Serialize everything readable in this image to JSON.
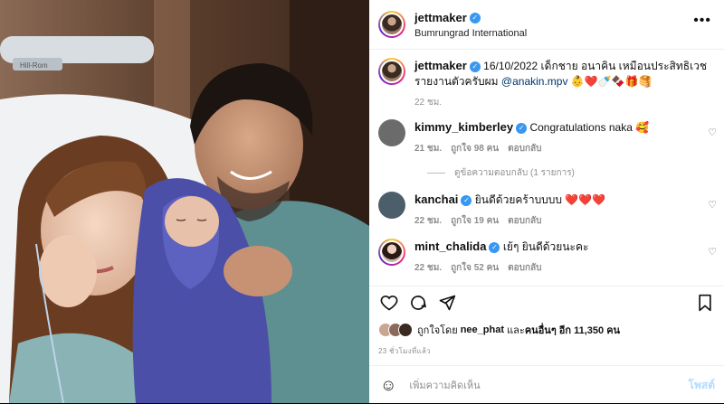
{
  "post_header": {
    "username": "jettmaker",
    "location": "Bumrungrad International",
    "more_icon": "more-horizontal-icon"
  },
  "caption": {
    "username": "jettmaker",
    "text": "16/10/2022 เด็กชาย อนาคิน เหมือนประสิทธิเวช รายงานตัวครับผม",
    "mention": "@anakin.mpv",
    "emojis": "👶❤️🍼🍫🎁🥞",
    "time": "22 ชม."
  },
  "comments": [
    {
      "username": "kimmy_kimberley",
      "text": "Congratulations naka 🥰",
      "time": "21 ชม.",
      "likes": "ถูกใจ 98 คน",
      "reply": "ตอบกลับ",
      "avatar_color": "#6b6b6b"
    },
    {
      "username": "kanchai",
      "text": "ยินดีด้วยคร้าบบบบ ❤️❤️❤️",
      "time": "22 ชม.",
      "likes": "ถูกใจ 19 คน",
      "reply": "ตอบกลับ",
      "avatar_color": "#4d5e6b"
    },
    {
      "username": "mint_chalida",
      "text": "เย้ๆ ยินดีด้วยนะคะ",
      "time": "22 ชม.",
      "likes": "ถูกใจ 52 คน",
      "reply": "ตอบกลับ",
      "avatar_color": "#7a5a50"
    }
  ],
  "view_replies": "ดูข้อความตอบกลับ (1 รายการ)",
  "likes_line": {
    "prefix": "ถูกใจโดย",
    "user": "nee_phat",
    "middle": "และ",
    "others": "คนอื่นๆ อีก 11,350 คน"
  },
  "posted_ago": "23 ชั่วโมงที่แล้ว",
  "composer": {
    "placeholder": "เพิ่มความคิดเห็น",
    "post_label": "โพสต์",
    "emoji_icon": "smiley-icon"
  },
  "icons": {
    "like": "heart-icon",
    "comment": "comment-icon",
    "share": "send-icon",
    "save": "bookmark-icon"
  },
  "colors": {
    "accent": "#3897f0",
    "mention": "#00376b",
    "post_disabled": "#b3dbff",
    "heart_red": "#ed4956"
  }
}
